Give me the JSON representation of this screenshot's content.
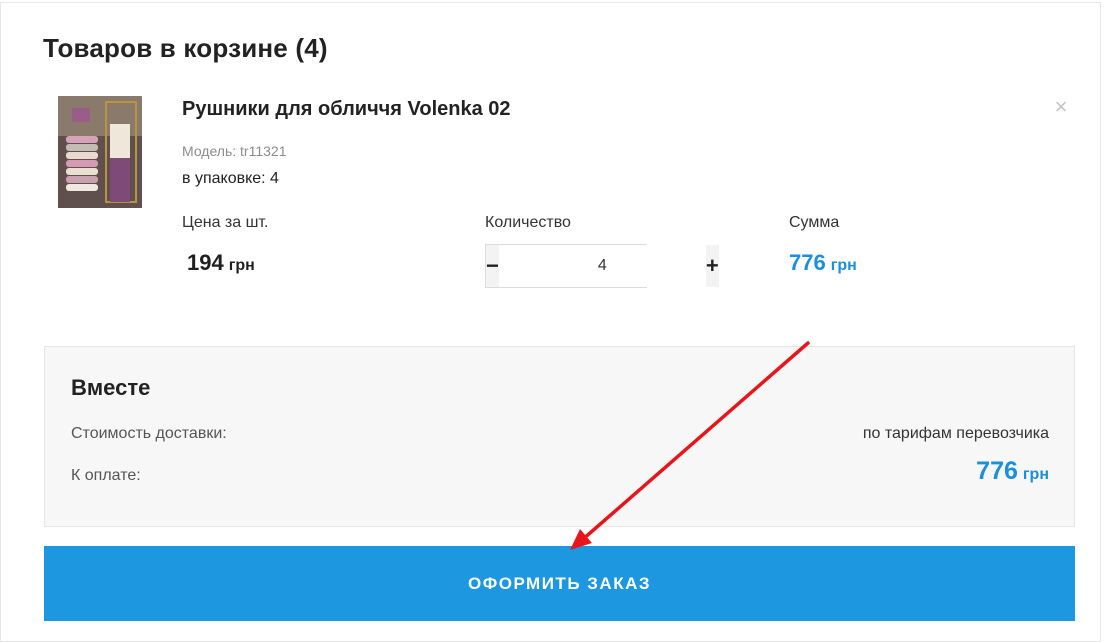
{
  "cart": {
    "title": "Товаров в корзине (4)"
  },
  "item": {
    "name": "Рушники для обличчя Volenka 02",
    "model": "Модель: tr11321",
    "package": "в упаковке: 4",
    "remove_glyph": "×",
    "columns": {
      "price": "Цена за шт.",
      "quantity": "Количество",
      "sum": "Сумма"
    },
    "price_value": "194",
    "quantity": "4",
    "sum_value": "776",
    "currency": "грн",
    "minus": "−",
    "plus": "+"
  },
  "summary": {
    "title": "Вместе",
    "delivery_label": "Стоимость доставки:",
    "delivery_value": "по тарифам перевозчика",
    "payable_label": "К оплате:",
    "payable_value": "776",
    "currency": "грн"
  },
  "checkout": {
    "label": "ОФОРМИТЬ ЗАКАЗ"
  },
  "colors": {
    "accent": "#1d97e0",
    "price_blue": "#1a8fdc",
    "annotation_arrow": "#e8161b"
  },
  "icons": {
    "remove": "close-icon",
    "annotation": "red-arrow"
  }
}
